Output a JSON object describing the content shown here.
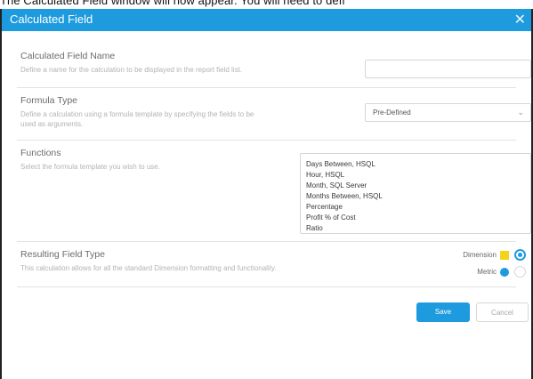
{
  "caption": "The Calculated Field window will now appear. You will need to defi",
  "dialog": {
    "title": "Calculated Field",
    "close_glyph": "✕",
    "close_icon": "close-icon"
  },
  "field_name": {
    "heading": "Calculated Field Name",
    "desc": "Define a name for the calculation to be displayed in the report field list.",
    "value": ""
  },
  "formula_type": {
    "heading": "Formula Type",
    "desc_line1": "Define a calculation using a formula template by specifying the fields to be",
    "desc_line2": "used as arguments.",
    "selected": "Pre-Defined",
    "chevron_glyph": "⌄",
    "chevron_icon": "chevron-down-icon"
  },
  "functions": {
    "heading": "Functions",
    "desc": "Select the formula template you wish to use.",
    "items": [
      "Days Between, HSQL",
      "Hour, HSQL",
      "Month, SQL Server",
      "Months Between, HSQL",
      "Percentage",
      "Profit % of Cost",
      "Ratio"
    ]
  },
  "result_type": {
    "heading": "Resulting Field Type",
    "desc": "This calculation allows for all the standard Dimension formatting and functionality.",
    "dimension_label": "Dimension",
    "metric_label": "Metric",
    "dimension_color": "#f5d31b",
    "metric_color": "#1e9bde",
    "selected": "Dimension"
  },
  "buttons": {
    "save": "Save",
    "cancel": "Cancel"
  },
  "colors": {
    "accent": "#1e9bde",
    "border": "#d6d6d6",
    "text_muted": "#b3b3b3"
  }
}
